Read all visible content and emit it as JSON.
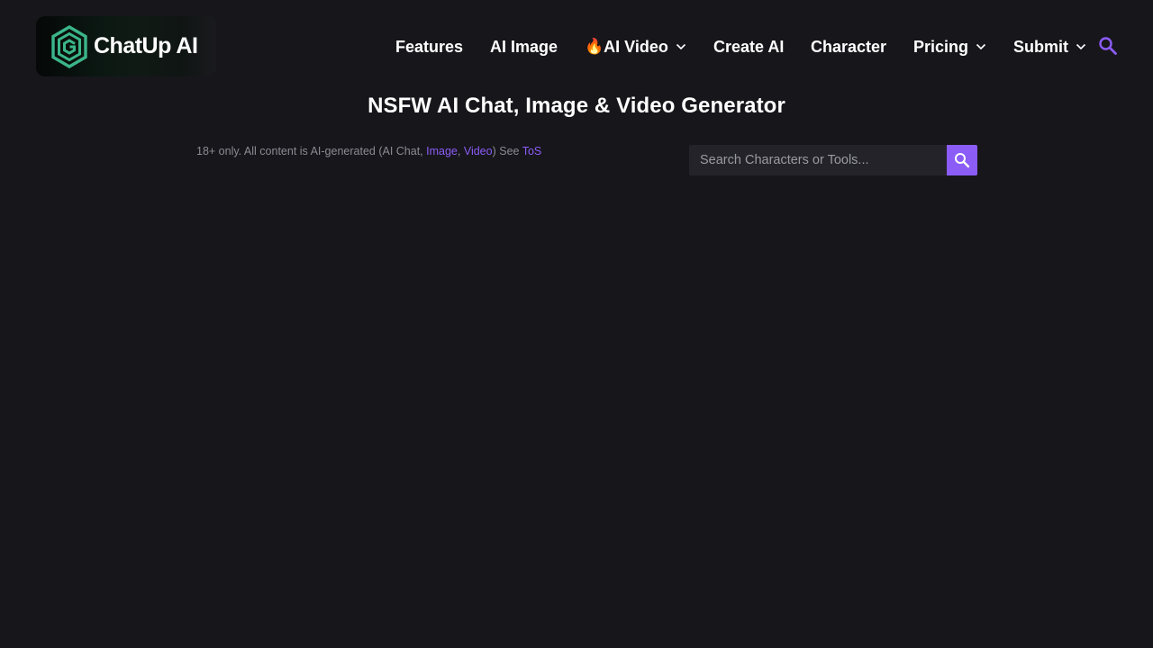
{
  "brand": {
    "name": "ChatUp AI",
    "accent_color": "#3bb58a"
  },
  "nav": {
    "items": [
      {
        "label": "Features",
        "has_dropdown": false
      },
      {
        "label": "AI Image",
        "has_dropdown": false
      },
      {
        "label": "AI Video",
        "prefix_icon": "fire-emoji",
        "prefix_glyph": "🔥",
        "has_dropdown": true
      },
      {
        "label": "Create AI",
        "has_dropdown": false
      },
      {
        "label": "Character",
        "has_dropdown": false
      },
      {
        "label": "Pricing",
        "has_dropdown": true
      },
      {
        "label": "Submit",
        "has_dropdown": true
      }
    ],
    "search_icon": "search-icon"
  },
  "page": {
    "title": "NSFW AI Chat, Image & Video Generator"
  },
  "disclaimer": {
    "prefix": "18+ only. All content is AI-generated (AI Chat, ",
    "link_image": "Image",
    "separator": ", ",
    "link_video": "Video",
    "middle": ") See ",
    "link_tos": "ToS"
  },
  "search": {
    "placeholder": "Search Characters or Tools...",
    "value": "",
    "button_icon": "search-icon"
  },
  "colors": {
    "background": "#17161b",
    "accent": "#8b5cf6",
    "text": "#ffffff",
    "muted_text": "#8c8b92"
  }
}
